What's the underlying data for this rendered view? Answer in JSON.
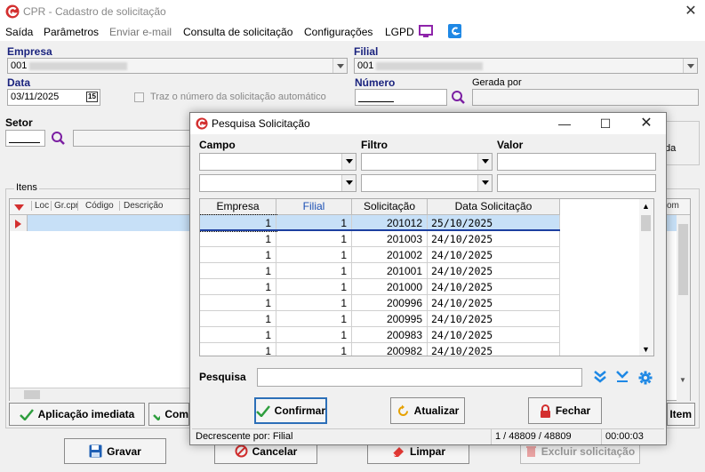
{
  "window": {
    "title": "CPR - Cadastro de solicitação",
    "close_glyph": "✕"
  },
  "menu": [
    {
      "label": "Saída",
      "enabled": true
    },
    {
      "label": "Parâmetros",
      "enabled": true
    },
    {
      "label": "Enviar e-mail",
      "enabled": false
    },
    {
      "label": "Consulta de solicitação",
      "enabled": true
    },
    {
      "label": "Configurações",
      "enabled": true
    },
    {
      "label": "LGPD",
      "enabled": true
    }
  ],
  "form": {
    "empresa_label": "Empresa",
    "empresa_value": "001",
    "filial_label": "Filial",
    "filial_value": "001",
    "data_label": "Data",
    "data_value": "03/11/2025",
    "calendar_glyph": "15",
    "auto_number_checkbox": "Traz o número da solicitação automático",
    "numero_label": "Número",
    "gerada_por_label": "Gerada por",
    "setor_label": "Setor",
    "right_partial_label": "da",
    "itens_group_label": "Itens",
    "grid_columns": [
      "Loc",
      "Gr.cpr",
      "Código",
      "Descrição"
    ],
    "right_col_partial": "om"
  },
  "footer_buttons": {
    "aplicacao": "Aplicação imediata",
    "com_partial": "Com",
    "item_partial": "Item",
    "gravar": "Gravar",
    "cancelar": "Cancelar",
    "limpar": "Limpar",
    "excluir": "Excluir solicitação"
  },
  "modal": {
    "title": "Pesquisa Solicitação",
    "campo_label": "Campo",
    "filtro_label": "Filtro",
    "valor_label": "Valor",
    "columns": [
      "Empresa",
      "Filial",
      "Solicitação",
      "Data Solicitação"
    ],
    "rows": [
      {
        "empresa": "1",
        "filial": "1",
        "solicitacao": "201012",
        "data": "25/10/2025"
      },
      {
        "empresa": "1",
        "filial": "1",
        "solicitacao": "201003",
        "data": "24/10/2025"
      },
      {
        "empresa": "1",
        "filial": "1",
        "solicitacao": "201002",
        "data": "24/10/2025"
      },
      {
        "empresa": "1",
        "filial": "1",
        "solicitacao": "201001",
        "data": "24/10/2025"
      },
      {
        "empresa": "1",
        "filial": "1",
        "solicitacao": "201000",
        "data": "24/10/2025"
      },
      {
        "empresa": "1",
        "filial": "1",
        "solicitacao": "200996",
        "data": "24/10/2025"
      },
      {
        "empresa": "1",
        "filial": "1",
        "solicitacao": "200995",
        "data": "24/10/2025"
      },
      {
        "empresa": "1",
        "filial": "1",
        "solicitacao": "200983",
        "data": "24/10/2025"
      },
      {
        "empresa": "1",
        "filial": "1",
        "solicitacao": "200982",
        "data": "24/10/2025"
      }
    ],
    "pesquisa_label": "Pesquisa",
    "confirmar": "Confirmar",
    "atualizar": "Atualizar",
    "fechar": "Fechar",
    "status_sort": "Decrescente por: Filial",
    "status_count": "1 / 48809 / 48809",
    "status_time": "00:00:03"
  },
  "colors": {
    "accent_blue": "#1a237e",
    "selection": "#c7e0f7",
    "brand_red": "#d32f2f",
    "check_green": "#2e9e3e"
  }
}
